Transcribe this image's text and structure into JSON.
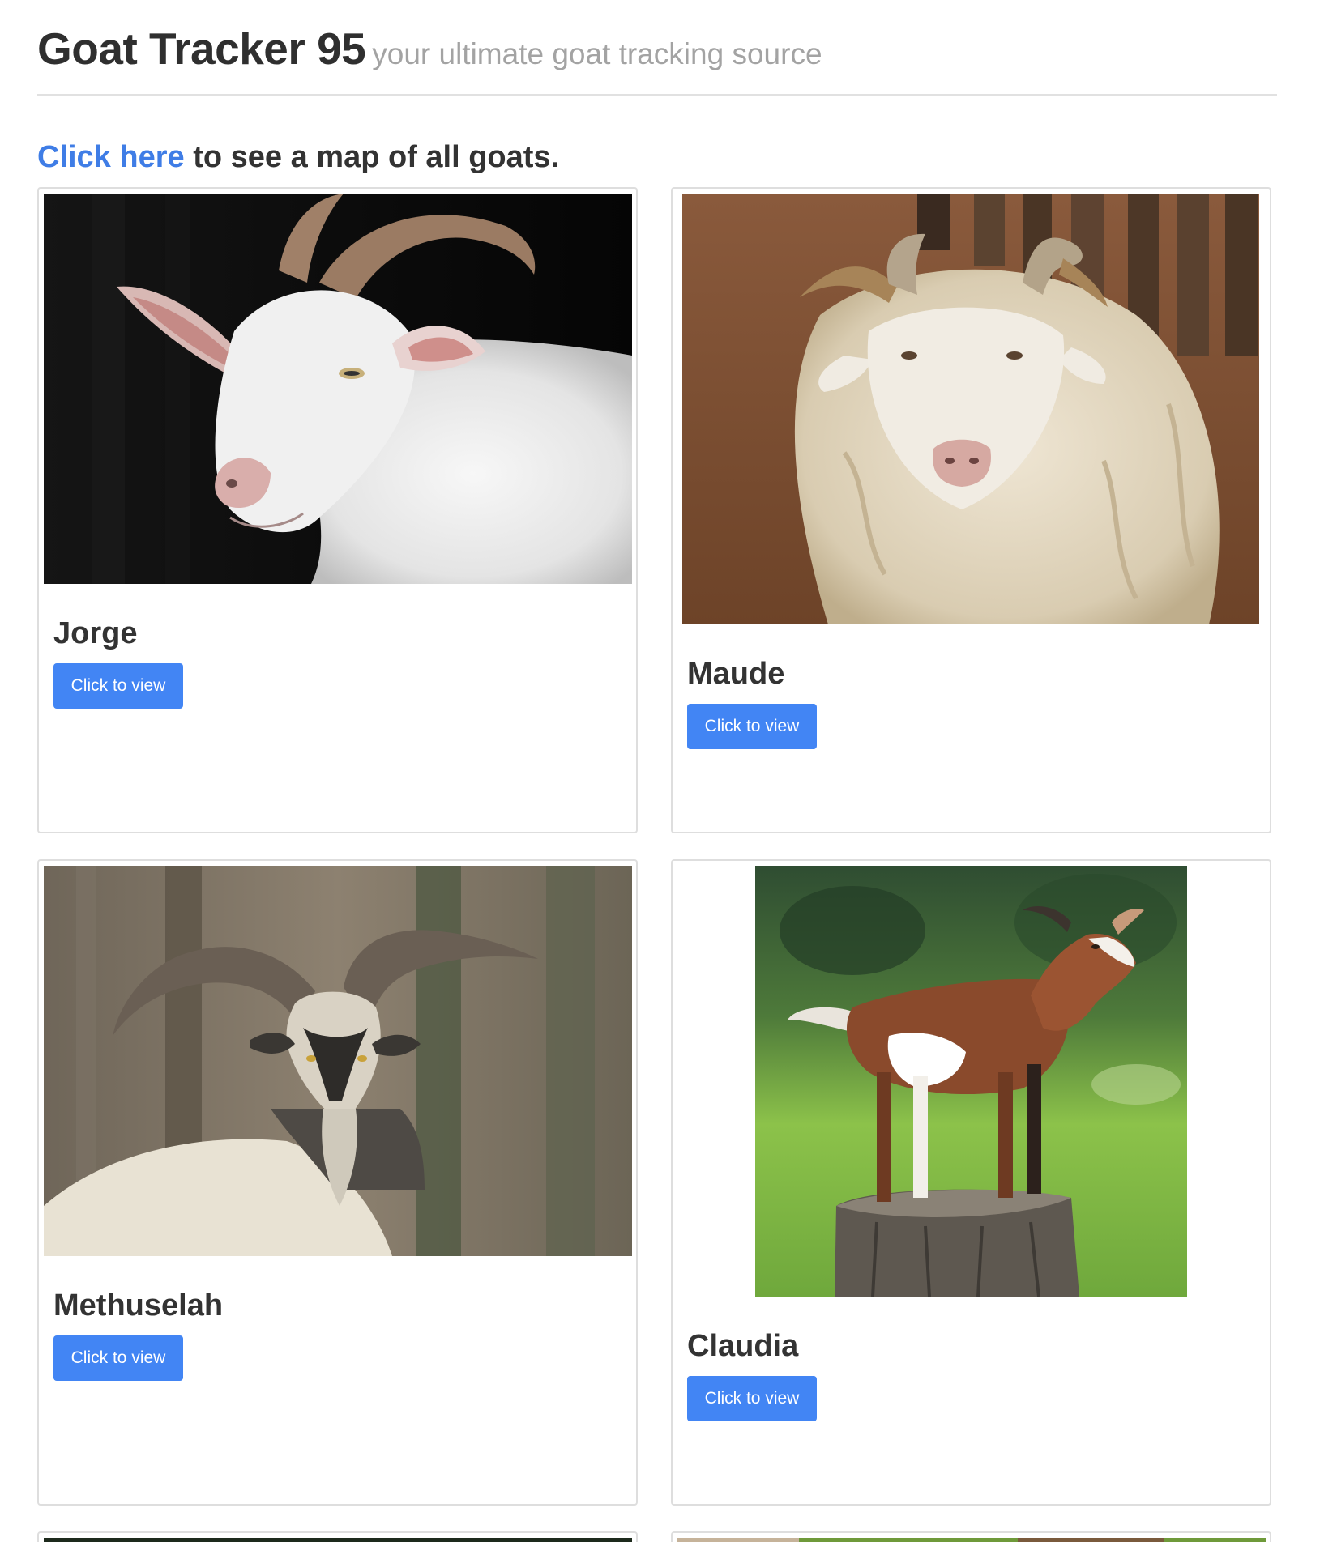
{
  "header": {
    "title": "Goat Tracker 95",
    "subtitle": "your ultimate goat tracking source"
  },
  "intro": {
    "link_label": "Click here",
    "rest": " to see a map of all goats."
  },
  "goats": [
    {
      "name": "Jorge",
      "button_label": "Click to view"
    },
    {
      "name": "Maude",
      "button_label": "Click to view"
    },
    {
      "name": "Methuselah",
      "button_label": "Click to view"
    },
    {
      "name": "Claudia",
      "button_label": "Click to view"
    }
  ],
  "colors": {
    "accent": "#4285f4",
    "link": "#3f7de6",
    "text": "#333333",
    "subtitle": "#a3a3a3",
    "border": "#dedede"
  }
}
